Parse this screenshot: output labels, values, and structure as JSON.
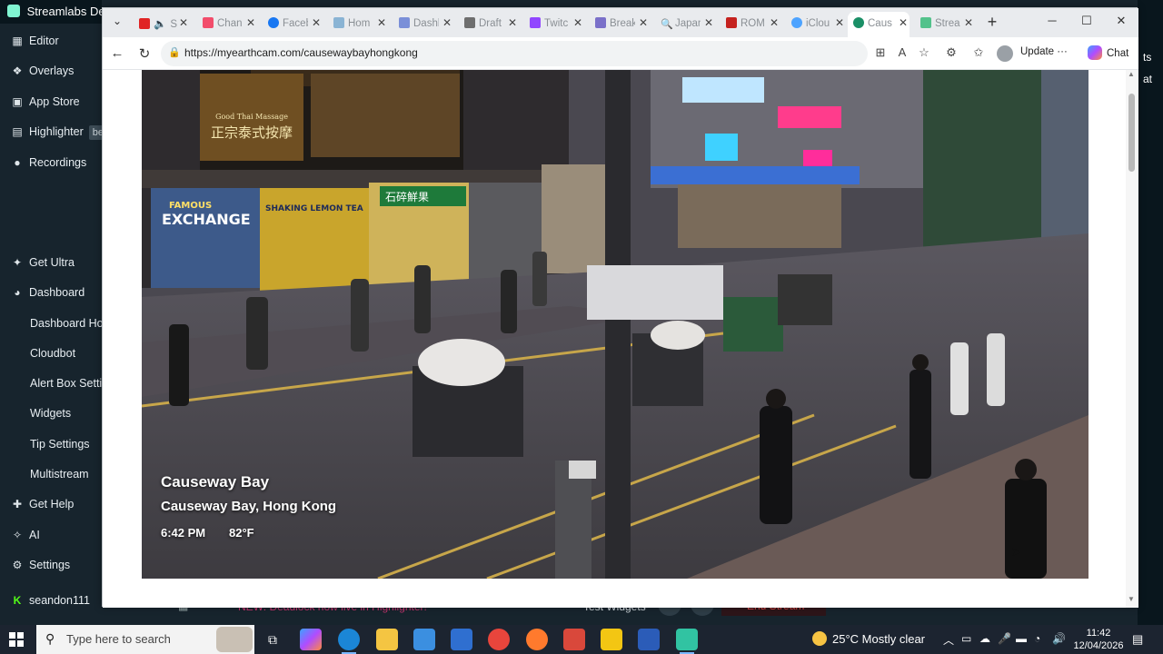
{
  "background_app": {
    "title": "Streamlabs De",
    "nav": [
      {
        "label": "Editor",
        "icon": "editor-icon"
      },
      {
        "label": "Overlays",
        "icon": "overlays-icon"
      },
      {
        "label": "App Store",
        "icon": "app-store-icon"
      },
      {
        "label": "Highlighter",
        "icon": "highlighter-icon",
        "badge": "be"
      },
      {
        "label": "Recordings",
        "icon": "recordings-icon"
      },
      {
        "label": "Get Ultra",
        "icon": "ultra-icon"
      },
      {
        "label": "Dashboard",
        "icon": "dashboard-icon"
      },
      {
        "label": "Dashboard Hor"
      },
      {
        "label": "Cloudbot"
      },
      {
        "label": "Alert Box Settin"
      },
      {
        "label": "Widgets"
      },
      {
        "label": "Tip Settings"
      },
      {
        "label": "Multistream"
      },
      {
        "label": "Get Help",
        "icon": "help-icon"
      },
      {
        "label": "AI",
        "icon": "ai-icon"
      },
      {
        "label": "Settings",
        "icon": "settings-icon"
      },
      {
        "label": "seandon111",
        "icon": "kick-icon"
      }
    ],
    "right_strip": {
      "line1": "ts",
      "line2": "at"
    },
    "bottom_strip": {
      "notice": "NEW: Deadlock now live in Highlighter!",
      "test_widgets": "Test Widgets",
      "end_stream": "End Stream"
    }
  },
  "browser": {
    "tabs": [
      {
        "label": "S",
        "favicon": "#e02424"
      },
      {
        "label": "Chan",
        "favicon": "#f24d6b"
      },
      {
        "label": "Faceb",
        "favicon": "#1877f2"
      },
      {
        "label": "Hom",
        "favicon": "#8ab4d4"
      },
      {
        "label": "Dashb",
        "favicon": "#7a8fd8"
      },
      {
        "label": "Draft",
        "favicon": "#6e6e6e"
      },
      {
        "label": "Twitc",
        "favicon": "#9146ff"
      },
      {
        "label": "Break",
        "favicon": "#7a70c9"
      },
      {
        "label": "Japan",
        "favicon": "#6a6a6a"
      },
      {
        "label": "ROM",
        "favicon": "#c5221f"
      },
      {
        "label": "iClou",
        "favicon": "#4da3ff"
      },
      {
        "label": "Caus",
        "favicon": "#1a8f66",
        "active": true
      },
      {
        "label": "Strea",
        "favicon": "#53c28b"
      }
    ],
    "url": "https://myearthcam.com/causewaybayhongkong",
    "update_label": "Update",
    "chat_label": "Chat"
  },
  "webcam": {
    "title": "Causeway Bay",
    "location": "Causeway Bay, Hong Kong",
    "time": "6:42 PM",
    "temperature": "82°F",
    "signs": {
      "massage_cn": "正宗泰式按摩",
      "massage_en": "Good Thai Massage",
      "exchange": "EXCHANGE",
      "famous": "FAMOUS",
      "lemon_tea": "SHAKING LEMON TEA",
      "fruit_cn": "石碎鮮果"
    }
  },
  "taskbar": {
    "search_placeholder": "Type here to search",
    "weather": "25°C  Mostly clear",
    "time": "11:42",
    "date": "12/04/2026"
  }
}
